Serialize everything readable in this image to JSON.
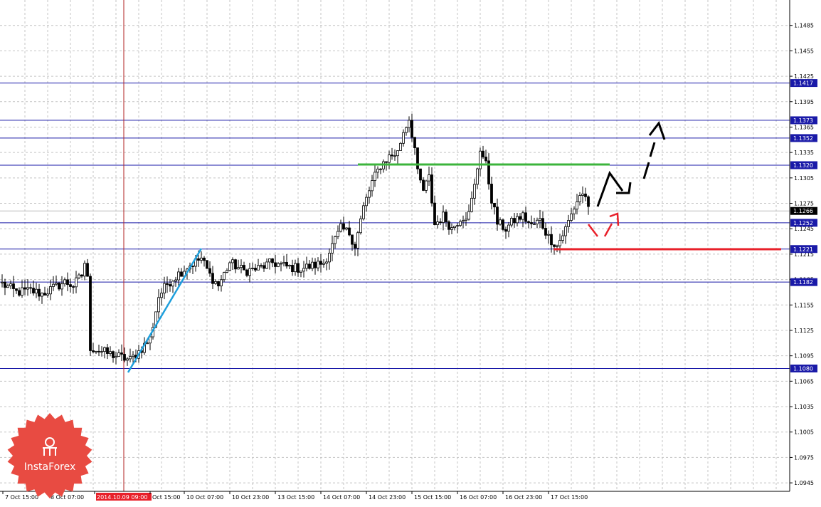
{
  "chart_data": {
    "type": "candlestick",
    "ylim": [
      1.0935,
      1.1515
    ],
    "grid": true,
    "price_ticks": [
      "1.1485",
      "1.1455",
      "1.1425",
      "1.1395",
      "1.1365",
      "1.1335",
      "1.1305",
      "1.1275",
      "1.1245",
      "1.1215",
      "1.1185",
      "1.1155",
      "1.1125",
      "1.1095",
      "1.1065",
      "1.1035",
      "1.1005",
      "1.0975",
      "1.0945"
    ],
    "date_labels": [
      "7 Oct 15:00",
      "8 Oct 07:00",
      "2014.10.09 09:00",
      "Oct 15:00",
      "10 Oct 07:00",
      "10 Oct 23:00",
      "13 Oct 15:00",
      "14 Oct 07:00",
      "14 Oct 23:00",
      "15 Oct 15:00",
      "16 Oct 07:00",
      "16 Oct 23:00",
      "17 Oct 15:00"
    ],
    "current_price": "1.1266",
    "levels": [
      {
        "label": "1.1417",
        "value": 1.1417
      },
      {
        "label": "1.1373",
        "value": 1.1373
      },
      {
        "label": "1.1352",
        "value": 1.1352
      },
      {
        "label": "1.1320",
        "value": 1.132
      },
      {
        "label": "1.1252",
        "value": 1.1252
      },
      {
        "label": "1.1221",
        "value": 1.1221
      },
      {
        "label": "1.1182",
        "value": 1.1182
      },
      {
        "label": "1.1080",
        "value": 1.108
      }
    ],
    "anchors": [
      {
        "bar": 0,
        "price": 1.118
      },
      {
        "bar": 5,
        "price": 1.117
      },
      {
        "bar": 10,
        "price": 1.1172
      },
      {
        "bar": 14,
        "price": 1.1168
      },
      {
        "bar": 18,
        "price": 1.1175
      },
      {
        "bar": 22,
        "price": 1.1182
      },
      {
        "bar": 25,
        "price": 1.1178
      },
      {
        "bar": 28,
        "price": 1.119
      },
      {
        "bar": 29,
        "price": 1.1205
      },
      {
        "bar": 30,
        "price": 1.1185
      },
      {
        "bar": 31,
        "price": 1.1105
      },
      {
        "bar": 35,
        "price": 1.11
      },
      {
        "bar": 40,
        "price": 1.1095
      },
      {
        "bar": 45,
        "price": 1.109
      },
      {
        "bar": 48,
        "price": 1.11
      },
      {
        "bar": 52,
        "price": 1.1115
      },
      {
        "bar": 55,
        "price": 1.1165
      },
      {
        "bar": 58,
        "price": 1.118
      },
      {
        "bar": 62,
        "price": 1.1192
      },
      {
        "bar": 65,
        "price": 1.12
      },
      {
        "bar": 70,
        "price": 1.121
      },
      {
        "bar": 73,
        "price": 1.119
      },
      {
        "bar": 76,
        "price": 1.1178
      },
      {
        "bar": 80,
        "price": 1.1205
      },
      {
        "bar": 85,
        "price": 1.1195
      },
      {
        "bar": 90,
        "price": 1.1198
      },
      {
        "bar": 95,
        "price": 1.1205
      },
      {
        "bar": 100,
        "price": 1.12
      },
      {
        "bar": 105,
        "price": 1.1198
      },
      {
        "bar": 110,
        "price": 1.1202
      },
      {
        "bar": 113,
        "price": 1.1205
      },
      {
        "bar": 116,
        "price": 1.1225
      },
      {
        "bar": 119,
        "price": 1.1245
      },
      {
        "bar": 122,
        "price": 1.124
      },
      {
        "bar": 124,
        "price": 1.1225
      },
      {
        "bar": 127,
        "price": 1.127
      },
      {
        "bar": 130,
        "price": 1.13
      },
      {
        "bar": 133,
        "price": 1.132
      },
      {
        "bar": 136,
        "price": 1.133
      },
      {
        "bar": 139,
        "price": 1.1335
      },
      {
        "bar": 141,
        "price": 1.136
      },
      {
        "bar": 143,
        "price": 1.1375
      },
      {
        "bar": 145,
        "price": 1.134
      },
      {
        "bar": 146,
        "price": 1.131
      },
      {
        "bar": 148,
        "price": 1.129
      },
      {
        "bar": 150,
        "price": 1.1305
      },
      {
        "bar": 152,
        "price": 1.125
      },
      {
        "bar": 155,
        "price": 1.126
      },
      {
        "bar": 158,
        "price": 1.1245
      },
      {
        "bar": 161,
        "price": 1.1258
      },
      {
        "bar": 164,
        "price": 1.1262
      },
      {
        "bar": 166,
        "price": 1.1295
      },
      {
        "bar": 168,
        "price": 1.134
      },
      {
        "bar": 170,
        "price": 1.132
      },
      {
        "bar": 172,
        "price": 1.128
      },
      {
        "bar": 174,
        "price": 1.1252
      },
      {
        "bar": 177,
        "price": 1.1245
      },
      {
        "bar": 180,
        "price": 1.1255
      },
      {
        "bar": 183,
        "price": 1.126
      },
      {
        "bar": 186,
        "price": 1.1248
      },
      {
        "bar": 189,
        "price": 1.1255
      },
      {
        "bar": 192,
        "price": 1.1235
      },
      {
        "bar": 195,
        "price": 1.1225
      },
      {
        "bar": 198,
        "price": 1.1245
      },
      {
        "bar": 201,
        "price": 1.127
      },
      {
        "bar": 203,
        "price": 1.1285
      },
      {
        "bar": 205,
        "price": 1.1285
      },
      {
        "bar": 206,
        "price": 1.1266
      }
    ]
  }
}
